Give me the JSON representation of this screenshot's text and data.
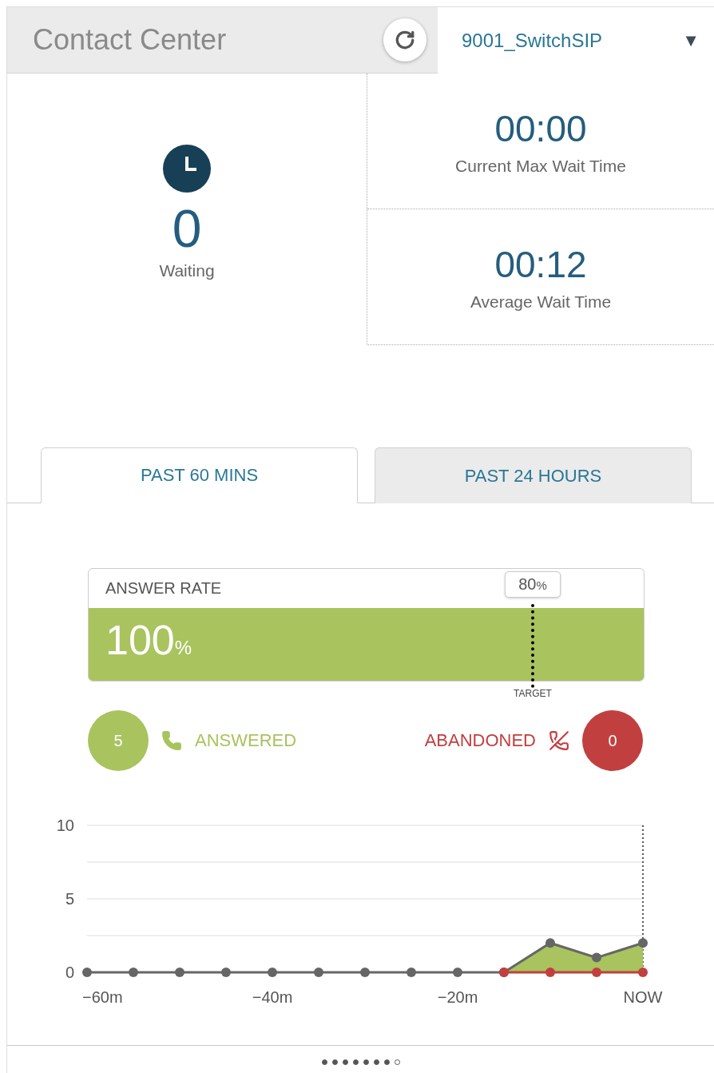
{
  "header": {
    "title": "Contact Center",
    "queue": {
      "value": "9001_SwitchSIP",
      "arrow": "▼"
    }
  },
  "waiting": {
    "value": "0",
    "label": "Waiting"
  },
  "stats": [
    {
      "value": "00:00",
      "label": "Current Max Wait Time"
    },
    {
      "value": "00:12",
      "label": "Average Wait Time"
    }
  ],
  "tabs": [
    {
      "label": "PAST 60 MINS",
      "selected": true
    },
    {
      "label": "PAST 24 HOURS",
      "selected": false
    }
  ],
  "answer_rate": {
    "title": "ANSWER RATE",
    "value": "100",
    "unit": "%",
    "level": 1,
    "target": {
      "value": "80",
      "unit": "%",
      "label": "TARGET",
      "level": 0.8
    }
  },
  "counts": [
    {
      "kind": "answered",
      "count": "5",
      "label": "ANSWERED",
      "color": "#a9c35e"
    },
    {
      "kind": "abandoned",
      "count": "0",
      "label": "ABANDONED",
      "color": "#c1403f"
    }
  ],
  "chart_data": {
    "type": "line",
    "x": [
      -60,
      -55,
      -50,
      -45,
      -40,
      -35,
      -30,
      -25,
      -20,
      -15,
      -10,
      -5,
      0
    ],
    "xlim": [
      -60,
      0
    ],
    "ylim": [
      0,
      10
    ],
    "yticks": [
      0,
      5,
      10
    ],
    "xticks": [
      {
        "value": -60,
        "label": "−60m"
      },
      {
        "value": -40,
        "label": "−40m"
      },
      {
        "value": -20,
        "label": "−20m"
      },
      {
        "value": 0,
        "label": "NOW"
      }
    ],
    "series": [
      {
        "color": "#666666",
        "marker": "circle",
        "values": [
          0,
          0,
          0,
          0,
          0,
          0,
          0,
          0,
          0,
          0,
          2,
          1,
          2
        ]
      },
      {
        "color": "#c1403f",
        "marker": "circle",
        "values": [
          null,
          null,
          null,
          null,
          null,
          null,
          null,
          null,
          null,
          0,
          0,
          0,
          0
        ]
      }
    ]
  },
  "pages": [
    {
      "selected": false
    },
    {
      "selected": false
    },
    {
      "selected": false
    },
    {
      "selected": false
    },
    {
      "selected": false
    },
    {
      "selected": false
    },
    {
      "selected": false
    },
    {
      "selected": true
    }
  ]
}
